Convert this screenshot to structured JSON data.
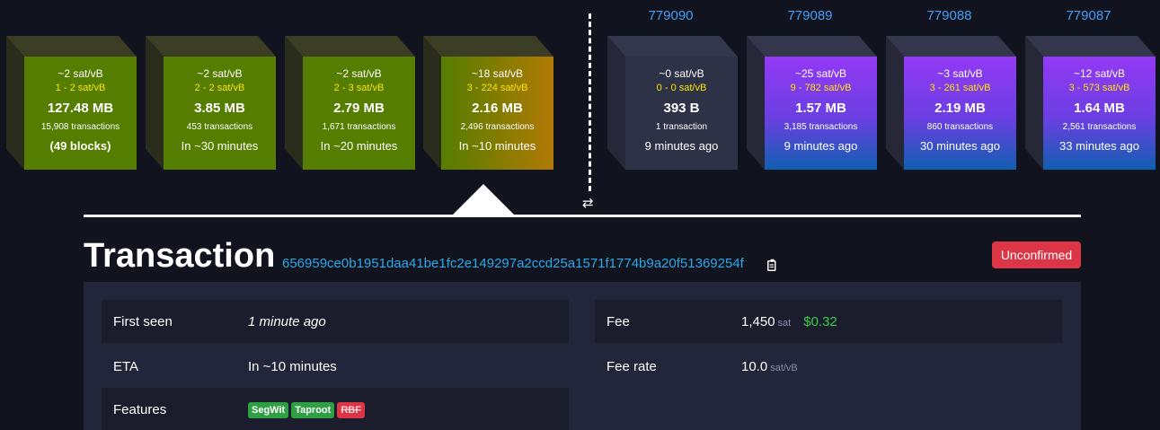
{
  "mempool_blocks": [
    {
      "median_fee": "~2 sat/vB",
      "fee_range": "1 - 2 sat/vB",
      "size": "127.48 MB",
      "tx_count": "15,908 transactions",
      "time": "(49 blocks)"
    },
    {
      "median_fee": "~2 sat/vB",
      "fee_range": "2 - 2 sat/vB",
      "size": "3.85 MB",
      "tx_count": "453 transactions",
      "time": "In ~30 minutes"
    },
    {
      "median_fee": "~2 sat/vB",
      "fee_range": "2 - 3 sat/vB",
      "size": "2.79 MB",
      "tx_count": "1,671 transactions",
      "time": "In ~20 minutes"
    },
    {
      "median_fee": "~18 sat/vB",
      "fee_range": "3 - 224 sat/vB",
      "size": "2.16 MB",
      "tx_count": "2,496 transactions",
      "time": "In ~10 minutes"
    }
  ],
  "mined_blocks": [
    {
      "height": "779090",
      "median_fee": "~0 sat/vB",
      "fee_range": "0 - 0 sat/vB",
      "size": "393 B",
      "tx_count": "1 transaction",
      "time": "9 minutes ago"
    },
    {
      "height": "779089",
      "median_fee": "~25 sat/vB",
      "fee_range": "9 - 782 sat/vB",
      "size": "1.57 MB",
      "tx_count": "3,185 transactions",
      "time": "9 minutes ago"
    },
    {
      "height": "779088",
      "median_fee": "~3 sat/vB",
      "fee_range": "3 - 261 sat/vB",
      "size": "2.19 MB",
      "tx_count": "860 transactions",
      "time": "30 minutes ago"
    },
    {
      "height": "779087",
      "median_fee": "~12 sat/vB",
      "fee_range": "3 - 573 sat/vB",
      "size": "1.64 MB",
      "tx_count": "2,561 transactions",
      "time": "33 minutes ago"
    }
  ],
  "icons": {
    "swap": "⇄",
    "copy": "copy-icon"
  },
  "transaction": {
    "title": "Transaction",
    "txid": "656959ce0b1951daa41be1fc2e149297a2ccd25a1571f1774b9a20f51369254f",
    "status": "Unconfirmed",
    "status_color": "#dc3545",
    "first_seen_label": "First seen",
    "first_seen_value": "1 minute ago",
    "eta_label": "ETA",
    "eta_value": "In ~10 minutes",
    "features_label": "Features",
    "features": [
      {
        "label": "SegWit",
        "state": "enabled"
      },
      {
        "label": "Taproot",
        "state": "enabled"
      },
      {
        "label": "RBF",
        "state": "disabled"
      }
    ],
    "fee_label": "Fee",
    "fee_value": "1,450",
    "fee_unit": "sat",
    "fee_usd": "$0.32",
    "fee_rate_label": "Fee rate",
    "fee_rate_value": "10.0",
    "fee_rate_unit": "sat/vB"
  }
}
